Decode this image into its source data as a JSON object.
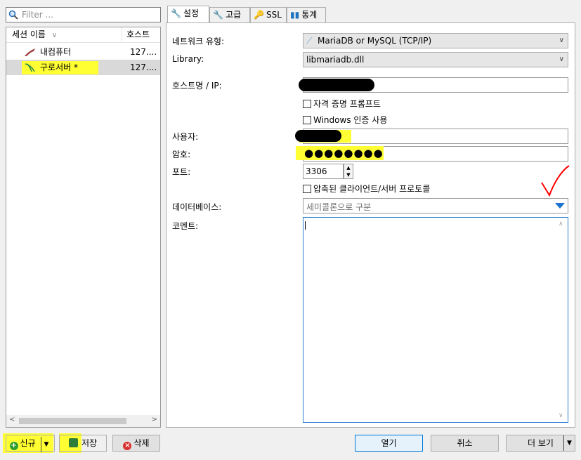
{
  "filter": {
    "placeholder": "Filter ..."
  },
  "sessions": {
    "columns": [
      "세션 이름",
      "호스트"
    ],
    "sort_indicator": "∨",
    "rows": [
      {
        "name": "내컴퓨터",
        "host": "127...."
      },
      {
        "name": "구로서버 *",
        "host": "127...."
      }
    ]
  },
  "left_buttons": {
    "new": "신규",
    "save": "저장",
    "delete": "삭제"
  },
  "tabs": [
    "설정",
    "고급",
    "SSL",
    "통계"
  ],
  "form": {
    "network_type_label": "네트워크 유형:",
    "network_type_value": "MariaDB or MySQL (TCP/IP)",
    "library_label": "Library:",
    "library_value": "libmariadb.dll",
    "host_label": "호스트명 / IP:",
    "prompt_credentials": "자격 증명 프롬프트",
    "windows_auth": "Windows 인증 사용",
    "user_label": "사용자:",
    "password_label": "암호:",
    "password_mask": "●●●●●●●●",
    "port_label": "포트:",
    "port_value": "3306",
    "compression": "압축된 클라이언트/서버 프로토콜",
    "database_label": "데이터베이스:",
    "database_placeholder": "세미콜론으로 구분",
    "comment_label": "코멘트:"
  },
  "bottom_buttons": {
    "open": "열기",
    "cancel": "취소",
    "more": "더 보기"
  },
  "colors": {
    "highlight": "#ffff33",
    "accent": "#0078d7",
    "memo_border": "#2c7fd2",
    "annotation": "#ff0000"
  }
}
